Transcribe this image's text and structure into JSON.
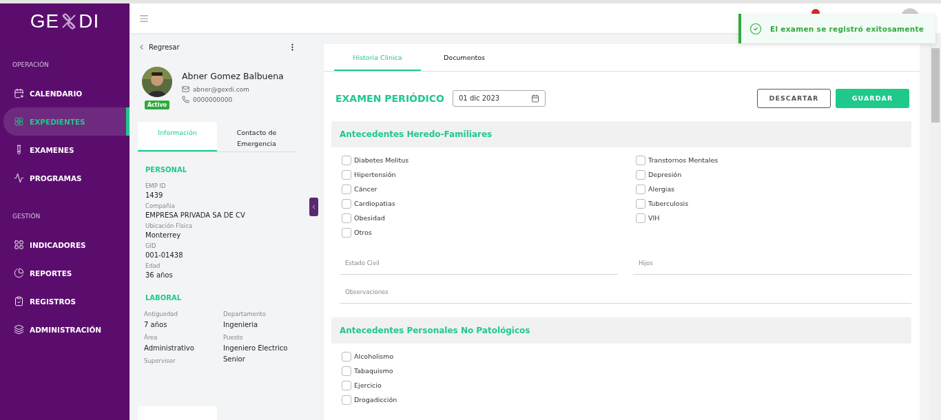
{
  "sidebar": {
    "logo_left": "GE",
    "logo_right": "DI",
    "sections": [
      {
        "title": "OPERACIÓN",
        "items": [
          {
            "label": "CALENDARIO",
            "selected": false
          },
          {
            "label": "EXPEDIENTES",
            "selected": true
          },
          {
            "label": "EXAMENES",
            "selected": false
          },
          {
            "label": "PROGRAMAS",
            "selected": false
          }
        ]
      },
      {
        "title": "GESTIÓN",
        "items": [
          {
            "label": "INDICADORES",
            "selected": false
          },
          {
            "label": "REPORTES",
            "selected": false
          },
          {
            "label": "REGISTROS",
            "selected": false
          },
          {
            "label": "ADMINISTRACIÓN",
            "selected": false
          }
        ]
      }
    ]
  },
  "toast": {
    "message": "El examen se registró exitosamente"
  },
  "profile": {
    "back": "Regresar",
    "name": "Abner Gomez Balbuena",
    "email": "abner@gexdi.com",
    "phone": "0000000000",
    "status": "Activo",
    "tabs": [
      {
        "label": "Información",
        "selected": true
      },
      {
        "label": "Contacto de Emergencia",
        "selected": false
      }
    ],
    "personal_title": "PERSONAL",
    "personal": [
      {
        "label": "EMP ID",
        "value": "1439"
      },
      {
        "label": "Compañia",
        "value": "EMPRESA PRIVADA SA DE CV"
      },
      {
        "label": "Ubicación Física",
        "value": "Monterrey"
      },
      {
        "label": "GID",
        "value": "001-01438"
      },
      {
        "label": "Edad",
        "value": "36 años"
      }
    ],
    "laboral_title": "LABORAL",
    "laboral_left": [
      {
        "label": "Antiguedad",
        "value": "7 años"
      },
      {
        "label": "Área",
        "value": "Administrativo"
      },
      {
        "label": "Supervisor"
      }
    ],
    "laboral_right": [
      {
        "label": "Departamento",
        "value": "Ingenieria"
      },
      {
        "label": "Puesto",
        "value": "Ingeniero Electrico Senior"
      }
    ]
  },
  "exam": {
    "tabs": [
      {
        "label": "Historia Clinica",
        "selected": true
      },
      {
        "label": "Documentos",
        "selected": false
      }
    ],
    "title": "EXAMEN PERIÓDICO",
    "date": "01 dic 2023",
    "discard": "DESCARTAR",
    "save": "GUARDAR",
    "sections": [
      {
        "title": "Antecedentes Heredo-Familiares",
        "column_1": [
          {
            "label": "Diabetes Melitus",
            "checked": false
          },
          {
            "label": "Hipertensión",
            "checked": false
          },
          {
            "label": "Cáncer",
            "checked": false
          },
          {
            "label": "Cardiopatias",
            "checked": false
          },
          {
            "label": "Obesidad",
            "checked": false
          },
          {
            "label": "Otros",
            "checked": false
          }
        ],
        "column_2": [
          {
            "label": "Transtornos Mentales",
            "checked": false
          },
          {
            "label": "Depresión",
            "checked": false
          },
          {
            "label": "Alergias",
            "checked": false
          },
          {
            "label": "Tuberculosis",
            "checked": false
          },
          {
            "label": "VIH",
            "checked": false
          }
        ],
        "field_rows": [
          [
            {
              "label": "Estado Civil"
            },
            {
              "label": "Hijos"
            }
          ],
          [
            {
              "label": "Observaciones"
            }
          ]
        ]
      },
      {
        "title": "Antecedentes Personales No Patológicos",
        "column_1": [
          {
            "label": "Alcoholismo",
            "checked": false
          },
          {
            "label": "Tabaquismo",
            "checked": false
          },
          {
            "label": "Ejercicio",
            "checked": false
          },
          {
            "label": "Drogadicción",
            "checked": false
          }
        ]
      }
    ]
  }
}
